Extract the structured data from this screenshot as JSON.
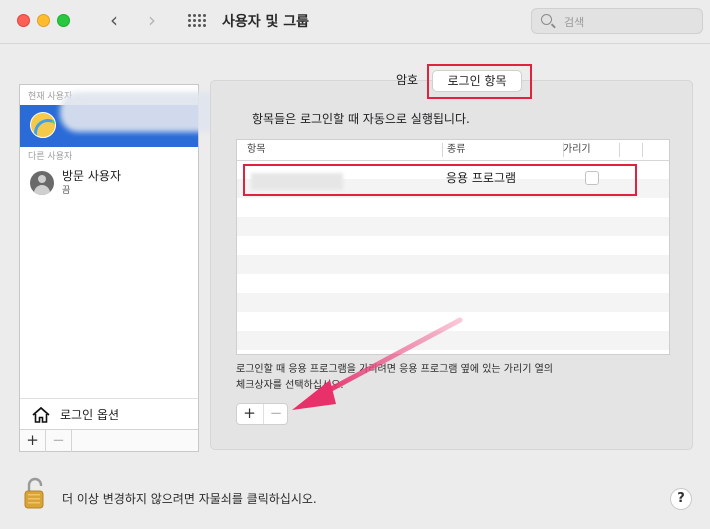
{
  "window": {
    "title": "사용자 및 그룹",
    "nav_back": "‹",
    "nav_forward": "›"
  },
  "search": {
    "placeholder": "검색"
  },
  "sidebar": {
    "current_user_header": "현재 사용자",
    "other_users_header": "다른 사용자",
    "guest_user": {
      "name": "방문 사용자",
      "status": "끔"
    },
    "login_options_label": "로그인 옵션",
    "add_button": "+",
    "remove_button": "−"
  },
  "tabs": [
    {
      "label": "암호"
    },
    {
      "label": "로그인 항목"
    }
  ],
  "login_items": {
    "description": "항목들은 로그인할 때 자동으로 실행됩니다.",
    "columns": [
      "항목",
      "종류",
      "가리기"
    ],
    "rows": [
      {
        "item": "",
        "kind": "응용 프로그램",
        "hide": false
      }
    ],
    "hint_line1": "로그인할 때 응용 프로그램을 가리려면 응용 프로그램 옆에 있는 가리기 열의",
    "hint_line2": "체크상자를 선택하십시오.",
    "add_button": "+",
    "remove_button": "−"
  },
  "footer": {
    "lock_text": "더 이상 변경하지 않으려면 자물쇠를 클릭하십시오.",
    "help_label": "?"
  },
  "colors": {
    "selection_blue": "#2a6bd8",
    "highlight_red": "#e0223f",
    "arrow_pink": "#e8306a"
  }
}
